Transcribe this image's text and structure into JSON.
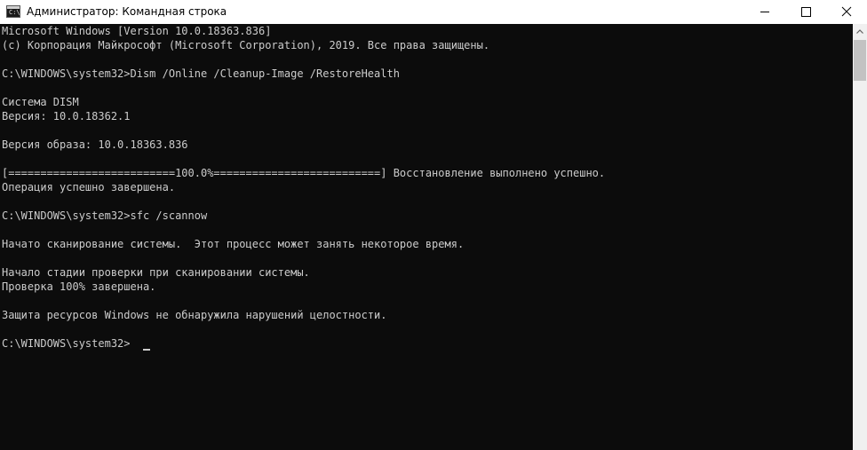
{
  "window": {
    "title": "Администратор: Командная строка",
    "icon_text": "C:\\"
  },
  "controls": {
    "minimize_icon": "minimize-icon",
    "maximize_icon": "maximize-icon",
    "close_icon": "close-icon"
  },
  "console": {
    "lines": [
      "Microsoft Windows [Version 10.0.18363.836]",
      "(c) Корпорация Майкрософт (Microsoft Corporation), 2019. Все права защищены.",
      "",
      "C:\\WINDOWS\\system32>Dism /Online /Cleanup-Image /RestoreHealth",
      "",
      "Cистема DISM",
      "Версия: 10.0.18362.1",
      "",
      "Версия образа: 10.0.18363.836",
      "",
      "[==========================100.0%==========================] Восстановление выполнено успешно.",
      "Операция успешно завершена.",
      "",
      "C:\\WINDOWS\\system32>sfc /scannow",
      "",
      "Начато сканирование системы.  Этот процесс может занять некоторое время.",
      "",
      "Начало стадии проверки при сканировании системы.",
      "Проверка 100% завершена.",
      "",
      "Защита ресурсов Windows не обнаружила нарушений целостности.",
      "",
      "C:\\WINDOWS\\system32>"
    ]
  },
  "colors": {
    "console_bg": "#0c0c0c",
    "console_fg": "#cccccc",
    "titlebar_bg": "#ffffff",
    "scrollbar_bg": "#f0f0f0",
    "scroll_thumb": "#c2c2c2"
  }
}
